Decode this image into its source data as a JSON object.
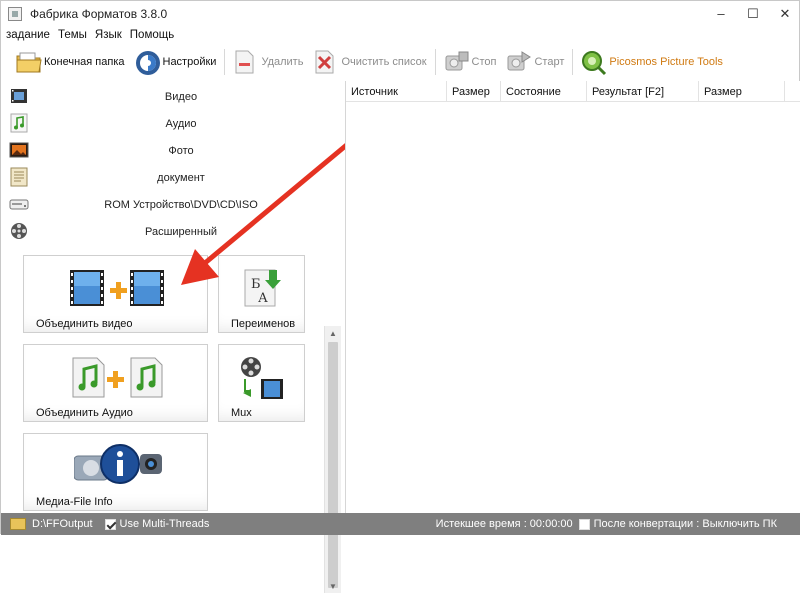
{
  "window": {
    "title": "Фабрика Форматов 3.8.0",
    "controls": {
      "minimize": "–",
      "maximize": "☐",
      "close": "✕"
    }
  },
  "menu": [
    "задание",
    "Темы",
    "Язык",
    "Помощь"
  ],
  "toolbar": {
    "output_folder": "Конечная папка",
    "settings": "Настройки",
    "delete": "Удалить",
    "clear_list": "Очистить список",
    "stop": "Стоп",
    "start": "Старт",
    "picosmos": "Picosmos Picture Tools"
  },
  "categories": [
    {
      "label": "Видео",
      "icon": "film-icon"
    },
    {
      "label": "Аудио",
      "icon": "music-note-icon"
    },
    {
      "label": "Фото",
      "icon": "photo-icon"
    },
    {
      "label": "документ",
      "icon": "document-icon"
    },
    {
      "label": "ROM Устройство\\DVD\\CD\\ISO",
      "icon": "disc-drive-icon"
    },
    {
      "label": "Расширенный",
      "icon": "film-reel-icon"
    }
  ],
  "tools": {
    "join_video": "Объединить видео",
    "rename": "Переименов",
    "join_audio": "Объединить Аудио",
    "mux": "Mux",
    "media_info": "Медиа-File Info"
  },
  "table": {
    "columns": [
      "Источник",
      "Размер",
      "Состояние",
      "Результат [F2]",
      "Размер"
    ]
  },
  "status": {
    "output_path": "D:\\FFOutput",
    "multithreads_label": "Use Multi-Threads",
    "multithreads_checked": true,
    "elapsed": "Истекшее время : 00:00:00",
    "after_convert": "После конвертации : Выключить ПК",
    "after_convert_checked": false
  },
  "colors": {
    "accent": "#d07a12",
    "statusbar": "#7f7f7f",
    "arrow": "#e53222"
  }
}
